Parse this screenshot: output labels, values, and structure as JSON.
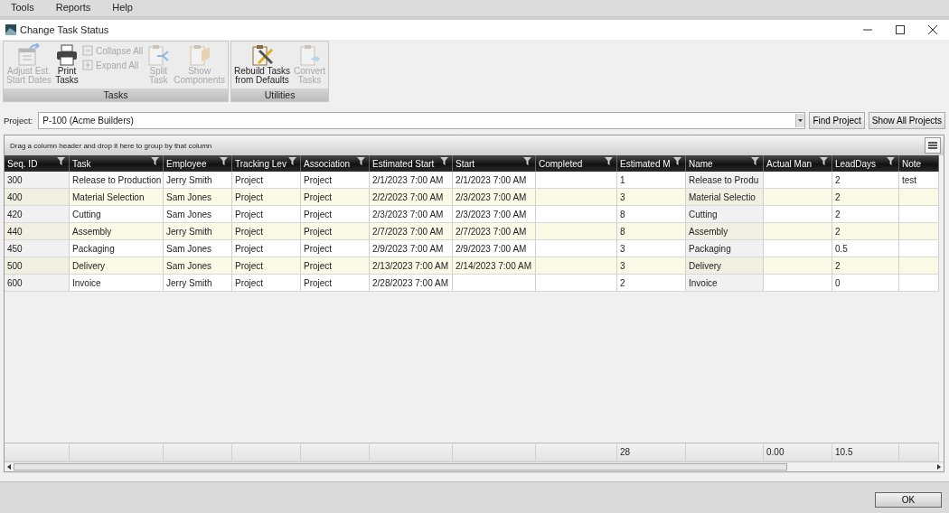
{
  "menu": [
    "Tools",
    "Reports",
    "Help"
  ],
  "window": {
    "title": "Change Task Status"
  },
  "ribbon": {
    "groups": [
      {
        "label": "Tasks",
        "buttons": [
          {
            "kind": "large",
            "label": "Adjust Est.\nStart Dates",
            "disabled": true
          },
          {
            "kind": "large",
            "label": "Print\nTasks",
            "disabled": false
          },
          {
            "kind": "stack",
            "items": [
              {
                "label": "Collapse All",
                "disabled": true
              },
              {
                "label": "Expand All",
                "disabled": true
              }
            ]
          },
          {
            "kind": "large",
            "label": "Split\nTask",
            "disabled": true
          },
          {
            "kind": "large",
            "label": "Show\nComponents",
            "disabled": true
          }
        ]
      },
      {
        "label": "Utilities",
        "buttons": [
          {
            "kind": "large",
            "label": "Rebuild Tasks\nfrom Defaults",
            "disabled": false
          },
          {
            "kind": "large",
            "label": "Convert\nTasks",
            "disabled": true
          }
        ]
      }
    ]
  },
  "project": {
    "label": "Project:",
    "value": "P-100 (Acme Builders)",
    "buttons": [
      "Find Project",
      "Show All Projects"
    ]
  },
  "grid": {
    "group_hint": "Drag a column header and drop it here to group by that column",
    "columns": [
      "Seq. ID",
      "Task",
      "Employee",
      "Tracking Lev",
      "Association",
      "Estimated Start",
      "Start",
      "Completed",
      "Estimated M",
      "Name",
      "Actual Man",
      "LeadDays",
      "Note"
    ],
    "rows": [
      [
        "300",
        "Release to Production",
        "Jerry Smith",
        "Project",
        "Project",
        "2/1/2023 7:00 AM",
        "2/1/2023 7:00 AM",
        "",
        "1",
        "Release to Produ",
        "",
        "2",
        "test"
      ],
      [
        "400",
        "Material Selection",
        "Sam Jones",
        "Project",
        "Project",
        "2/2/2023 7:00 AM",
        "2/3/2023 7:00 AM",
        "",
        "3",
        "Material Selectio",
        "",
        "2",
        ""
      ],
      [
        "420",
        "Cutting",
        "Sam Jones",
        "Project",
        "Project",
        "2/3/2023 7:00 AM",
        "2/3/2023 7:00 AM",
        "",
        "8",
        "Cutting",
        "",
        "2",
        ""
      ],
      [
        "440",
        "Assembly",
        "Jerry Smith",
        "Project",
        "Project",
        "2/7/2023 7:00 AM",
        "2/7/2023 7:00 AM",
        "",
        "8",
        "Assembly",
        "",
        "2",
        ""
      ],
      [
        "450",
        "Packaging",
        "Sam Jones",
        "Project",
        "Project",
        "2/9/2023 7:00 AM",
        "2/9/2023 7:00 AM",
        "",
        "3",
        "Packaging",
        "",
        "0.5",
        ""
      ],
      [
        "500",
        "Delivery",
        "Sam Jones",
        "Project",
        "Project",
        "2/13/2023 7:00 AM",
        "2/14/2023 7:00 AM",
        "",
        "3",
        "Delivery",
        "",
        "2",
        ""
      ],
      [
        "600",
        "Invoice",
        "Jerry Smith",
        "Project",
        "Project",
        "2/28/2023 7:00 AM",
        "",
        "",
        "2",
        "Invoice",
        "",
        "0",
        ""
      ]
    ],
    "totals": {
      "estimated_m": "28",
      "actual_man": "0.00",
      "lead_days": "10.5"
    }
  },
  "ok_button": "OK"
}
